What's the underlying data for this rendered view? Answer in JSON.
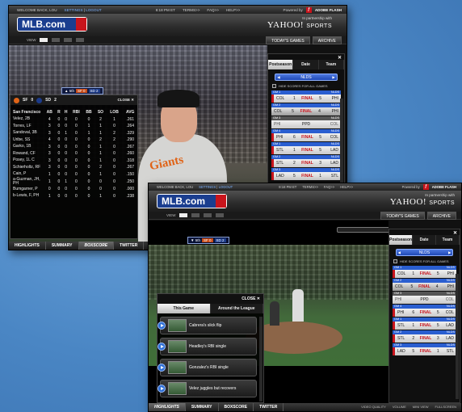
{
  "top_bar": {
    "welcome": "WELCOME BACK,",
    "user": "LOU",
    "settings": "SETTINGS",
    "separator": "|",
    "logout": "LOGOUT",
    "time": "8:18 PM ET",
    "terms": "TERMS>>",
    "faq": "FAQ>>",
    "help": "HELP>>",
    "powered_by": "Powered by",
    "adobe": "ADOBE",
    "flash": "FLASH"
  },
  "header": {
    "logo_text": "MLB.com",
    "partner_line": "In partnership with",
    "yahoo": "YAHOO!",
    "sports": "SPORTS"
  },
  "view_bar": {
    "view_label": "VIEW",
    "todays_games": "TODAY'S GAMES",
    "archive": "ARCHIVE"
  },
  "scoreboard_panel": {
    "tabs": [
      "Postseason",
      "Date",
      "Team"
    ],
    "close": "✕",
    "selector": "NLDS",
    "hide_scores": "HIDE SCORES FOR ALL GAMES",
    "games": [
      {
        "label": "GM 1",
        "series": "NLDS",
        "away": "COL",
        "away_score": "1",
        "status": "FINAL",
        "home_score": "5",
        "home": "PHI",
        "style": "red"
      },
      {
        "label": "GM 2",
        "series": "NLDS",
        "away": "COL",
        "away_score": "5",
        "status": "FINAL",
        "home_score": "4",
        "home": "PHI",
        "style": "sel"
      },
      {
        "label": "GM 3",
        "series": "NLDS",
        "away": "PHI",
        "away_score": "",
        "status": "PPD",
        "home_score": "",
        "home": "COL",
        "style": "gray"
      },
      {
        "label": "GM 4",
        "series": "NLDS",
        "away": "PHI",
        "away_score": "6",
        "status": "FINAL",
        "home_score": "5",
        "home": "COL",
        "style": "red"
      },
      {
        "label": "GM 1",
        "series": "NLDS",
        "away": "STL",
        "away_score": "1",
        "status": "FINAL",
        "home_score": "5",
        "home": "LAD",
        "style": "red"
      },
      {
        "label": "GM 2",
        "series": "NLDS",
        "away": "STL",
        "away_score": "2",
        "status": "FINAL",
        "home_score": "3",
        "home": "LAD",
        "style": "red"
      },
      {
        "label": "GM 3",
        "series": "NLDS",
        "away": "LAD",
        "away_score": "5",
        "status": "FINAL",
        "home_score": "1",
        "home": "STL",
        "style": "red"
      }
    ]
  },
  "back_scorebug": {
    "inning": "▲ 5th",
    "away": "SF",
    "away_score": "0",
    "home": "SD",
    "home_score": "2"
  },
  "front_scorebug": {
    "inning": "▼ 5th",
    "away": "SF",
    "away_score": "0",
    "home": "SD",
    "home_score": "2"
  },
  "jersey_text": "Giants",
  "boxscore": {
    "away_abbr": "SF",
    "away_score": "0",
    "home_abbr": "SD",
    "home_score": "2",
    "close": "CLOSE ✕",
    "team": "San Francisco",
    "columns": [
      "AB",
      "R",
      "H",
      "RBI",
      "BB",
      "SO",
      "LOB",
      "AVG"
    ],
    "rows": [
      [
        "Velez, 2B",
        "4",
        "0",
        "0",
        "0",
        "0",
        "2",
        "1",
        ".261"
      ],
      [
        "Torres, LF",
        "3",
        "0",
        "0",
        "0",
        "1",
        "1",
        "0",
        ".264"
      ],
      [
        "Sandoval, 3B",
        "3",
        "0",
        "1",
        "0",
        "1",
        "1",
        "2",
        ".329"
      ],
      [
        "Uribe, SS",
        "4",
        "0",
        "0",
        "0",
        "0",
        "2",
        "2",
        ".290"
      ],
      [
        "Garko, 1B",
        "3",
        "0",
        "0",
        "0",
        "0",
        "1",
        "0",
        ".267"
      ],
      [
        "Rowand, CF",
        "3",
        "0",
        "0",
        "0",
        "0",
        "1",
        "0",
        ".260"
      ],
      [
        "Posey, 1L C",
        "3",
        "0",
        "0",
        "0",
        "0",
        "1",
        "0",
        ".318"
      ],
      [
        "Schierholtz, RF",
        "3",
        "0",
        "0",
        "0",
        "0",
        "2",
        "0",
        ".267"
      ],
      [
        "Cain, P",
        "1",
        "0",
        "0",
        "0",
        "0",
        "1",
        "0",
        ".150"
      ],
      [
        "a-Guzman, JH, PH",
        "1",
        "0",
        "1",
        "0",
        "0",
        "0",
        "0",
        ".250"
      ],
      [
        "Bumgarner, P",
        "0",
        "0",
        "0",
        "0",
        "0",
        "0",
        "0",
        ".000"
      ],
      [
        "b-Lewis, F, PH",
        "1",
        "0",
        "0",
        "0",
        "0",
        "1",
        "0",
        ".238"
      ]
    ]
  },
  "bottom_tabs": [
    "HIGHLIGHTS",
    "SUMMARY",
    "BOXSCORE",
    "TWITTER"
  ],
  "bottom_right": {
    "video_quality": "VIDEO QUALITY",
    "volume": "VOLUME",
    "mini_view": "MINI VIEW",
    "fullscreen": "FULLSCREEN"
  },
  "plays_panel": {
    "close": "CLOSE ✕",
    "tabs": [
      "This Game",
      "Around the League"
    ],
    "items": [
      "Cabrera's slick flip",
      "Headley's RBI single",
      "Gonzalez's RBI single",
      "Velez juggles but recovers"
    ]
  }
}
